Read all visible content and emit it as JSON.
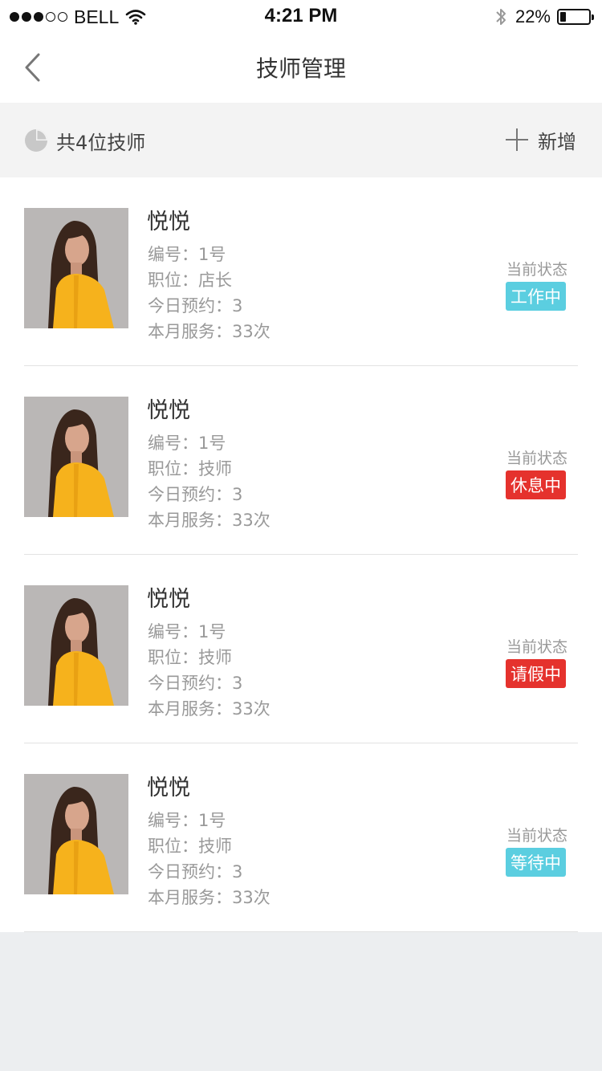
{
  "status_bar": {
    "carrier": "BELL",
    "time": "4:21 PM",
    "battery": "22%",
    "battery_level": 0.22,
    "signal_bars": 3,
    "signal_total": 5
  },
  "nav": {
    "title": "技师管理",
    "back_icon": "chevron-left-icon"
  },
  "summary": {
    "count_text": "共4位技师",
    "add_label": "新增"
  },
  "technicians": [
    {
      "name": "悦悦",
      "number": "编号：1号",
      "position": "职位：店长",
      "appointments": "今日预约：3",
      "monthly": "本月服务：33次",
      "status_label": "当前状态",
      "status": "工作中",
      "status_color": "#5bcee0"
    },
    {
      "name": "悦悦",
      "number": "编号：1号",
      "position": "职位：技师",
      "appointments": "今日预约：3",
      "monthly": "本月服务：33次",
      "status_label": "当前状态",
      "status": "休息中",
      "status_color": "#e5322d"
    },
    {
      "name": "悦悦",
      "number": "编号：1号",
      "position": "职位：技师",
      "appointments": "今日预约：3",
      "monthly": "本月服务：33次",
      "status_label": "当前状态",
      "status": "请假中",
      "status_color": "#e5322d"
    },
    {
      "name": "悦悦",
      "number": "编号：1号",
      "position": "职位：技师",
      "appointments": "今日预约：3",
      "monthly": "本月服务：33次",
      "status_label": "当前状态",
      "status": "等待中",
      "status_color": "#5bcee0"
    }
  ]
}
